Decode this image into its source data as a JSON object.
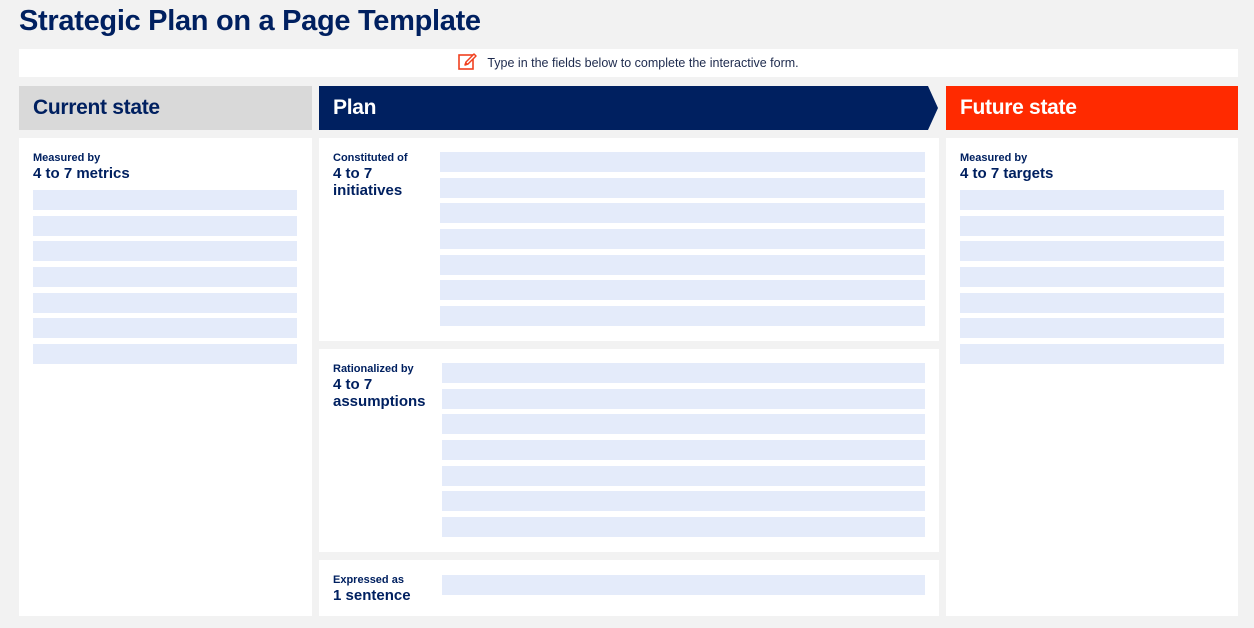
{
  "page": {
    "title": "Strategic Plan on a Page Template",
    "instruction": "Type in the fields below to complete the interactive form.",
    "instruction_icon": "edit-icon"
  },
  "colors": {
    "navy": "#002060",
    "orange": "#ff2a00",
    "grey_header": "#d9d9d9",
    "field_bg": "#e4ebfa",
    "background": "#f2f2f2"
  },
  "current_state": {
    "header": "Current state",
    "label_small": "Measured by",
    "label_big": "4 to 7 metrics",
    "fields": [
      "",
      "",
      "",
      "",
      "",
      "",
      ""
    ]
  },
  "plan": {
    "header": "Plan",
    "initiatives": {
      "label_small": "Constituted of",
      "label_big_line1": "4 to 7",
      "label_big_line2": "initiatives",
      "fields": [
        "",
        "",
        "",
        "",
        "",
        "",
        ""
      ]
    },
    "assumptions": {
      "label_small": "Rationalized by",
      "label_big_line1": "4 to 7",
      "label_big_line2": "assumptions",
      "fields": [
        "",
        "",
        "",
        "",
        "",
        "",
        ""
      ]
    },
    "sentence": {
      "label_small": "Expressed as",
      "label_big": "1 sentence",
      "fields": [
        ""
      ]
    }
  },
  "future_state": {
    "header": "Future state",
    "label_small": "Measured by",
    "label_big": "4 to 7 targets",
    "fields": [
      "",
      "",
      "",
      "",
      "",
      "",
      ""
    ]
  }
}
